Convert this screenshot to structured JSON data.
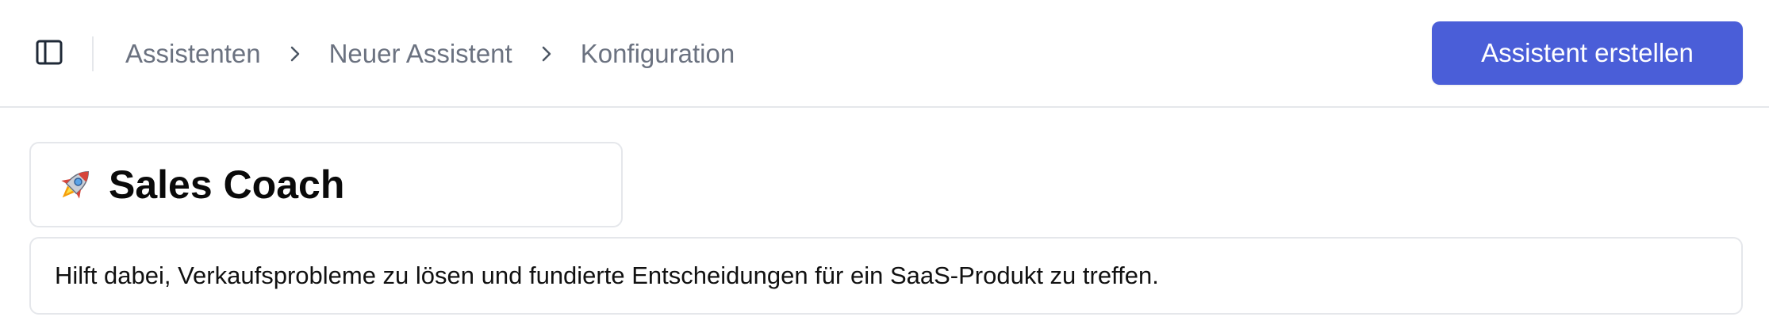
{
  "header": {
    "sidebar_toggle_icon": "sidebar-panel-icon",
    "breadcrumb": [
      {
        "label": "Assistenten"
      },
      {
        "label": "Neuer Assistent"
      },
      {
        "label": "Konfiguration"
      }
    ],
    "separator_icon": "chevron-right-icon",
    "primary_button_label": "Assistent erstellen"
  },
  "assistant": {
    "icon": "rocket-icon",
    "name": "Sales Coach",
    "description": "Hilft dabei, Verkaufsprobleme zu lösen und fundierte Entscheidungen für ein SaaS-Produkt zu treffen."
  },
  "colors": {
    "accent": "#4a5ed8",
    "breadcrumb_text": "#6b7280",
    "border": "#e5e7eb"
  }
}
